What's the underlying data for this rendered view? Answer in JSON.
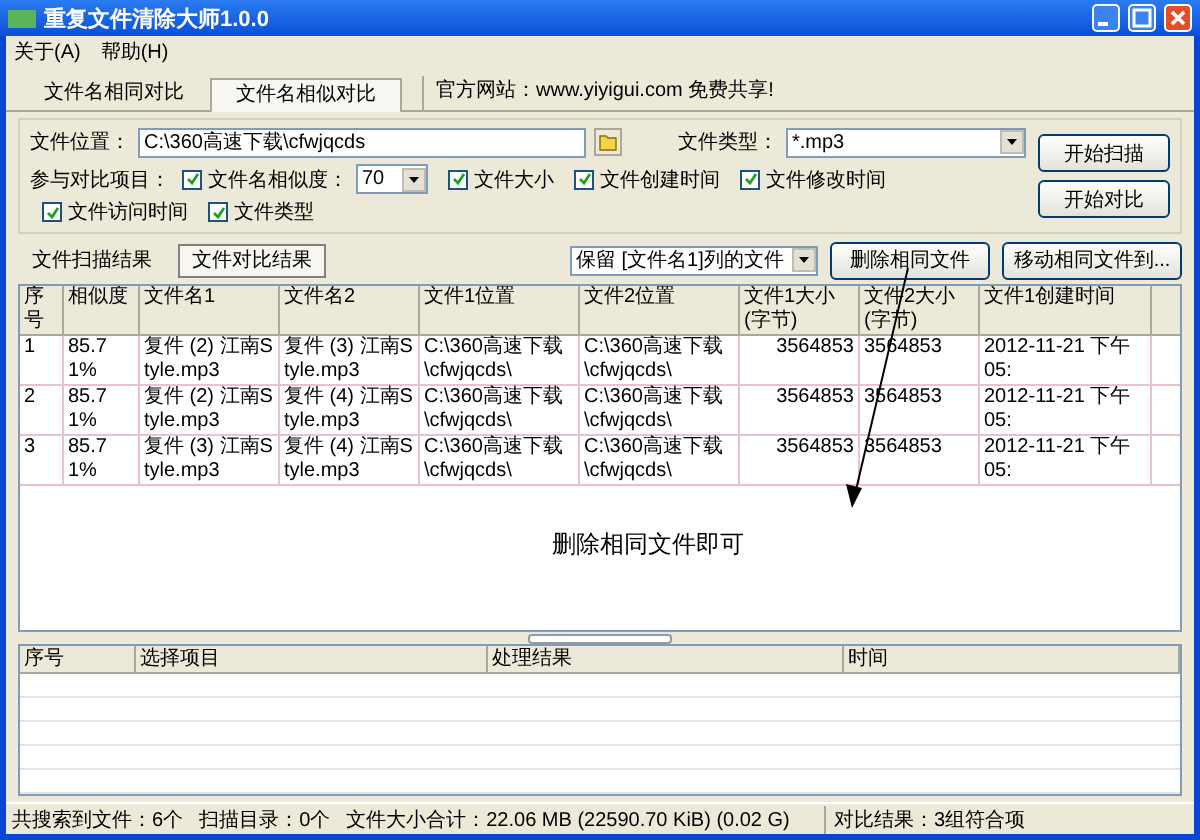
{
  "window": {
    "title": "重复文件清除大师1.0.0"
  },
  "menu": [
    "关于(A)",
    "帮助(H)"
  ],
  "tabs": [
    {
      "label": "文件名相同对比",
      "selected": false
    },
    {
      "label": "文件名相似对比",
      "selected": true
    }
  ],
  "website": "官方网站：www.yiyigui.com 免费共享!",
  "location": {
    "label": "文件位置：",
    "value": "C:\\360高速下载\\cfwjqcds"
  },
  "file_type": {
    "label": "文件类型：",
    "value": "*.mp3"
  },
  "buttons": [
    "开始扫描",
    "开始对比"
  ],
  "compare_label": "参与对比项目：",
  "similarity": {
    "label": "文件名相似度：",
    "checked": true,
    "value": "70"
  },
  "options": [
    {
      "label": "文件大小",
      "checked": true
    },
    {
      "label": "文件创建时间",
      "checked": true
    },
    {
      "label": "文件修改时间",
      "checked": true
    },
    {
      "label": "文件访问时间",
      "checked": true
    },
    {
      "label": "文件类型",
      "checked": true
    }
  ],
  "result_tabs": [
    {
      "label": "文件扫描结果",
      "selected": false
    },
    {
      "label": "文件对比结果",
      "selected": true
    }
  ],
  "keep_select": "保留 [文件名1]列的文件",
  "action_buttons": [
    "删除相同文件",
    "移动相同文件到..."
  ],
  "table": {
    "columns": [
      "序号",
      "相似度",
      "文件名1",
      "文件名2",
      "文件1位置",
      "文件2位置",
      "文件1大小(字节)",
      "文件2大小(字节)",
      "文件1创建时间"
    ],
    "rows": [
      [
        "1",
        "85.71%",
        "复件 (2) 江南Style.mp3",
        "复件 (3) 江南Style.mp3",
        "C:\\360高速下载\\cfwjqcds\\",
        "C:\\360高速下载\\cfwjqcds\\",
        "3564853",
        "3564853",
        "2012-11-21 下午 05:"
      ],
      [
        "2",
        "85.71%",
        "复件 (2) 江南Style.mp3",
        "复件 (4) 江南Style.mp3",
        "C:\\360高速下载\\cfwjqcds\\",
        "C:\\360高速下载\\cfwjqcds\\",
        "3564853",
        "3564853",
        "2012-11-21 下午 05:"
      ],
      [
        "3",
        "85.71%",
        "复件 (3) 江南Style.mp3",
        "复件 (4) 江南Style.mp3",
        "C:\\360高速下载\\cfwjqcds\\",
        "C:\\360高速下载\\cfwjqcds\\",
        "3564853",
        "3564853",
        "2012-11-21 下午 05:"
      ]
    ]
  },
  "annotation": "删除相同文件即可",
  "log_table": {
    "columns": [
      "序号",
      "选择项目",
      "处理结果",
      "时间"
    ]
  },
  "status_bar": {
    "files": "共搜索到文件：6个",
    "dirs": "扫描目录：0个",
    "size": "文件大小合计：22.06 MB (22590.70 KiB) (0.02 G)",
    "result": "对比结果：3组符合项"
  }
}
